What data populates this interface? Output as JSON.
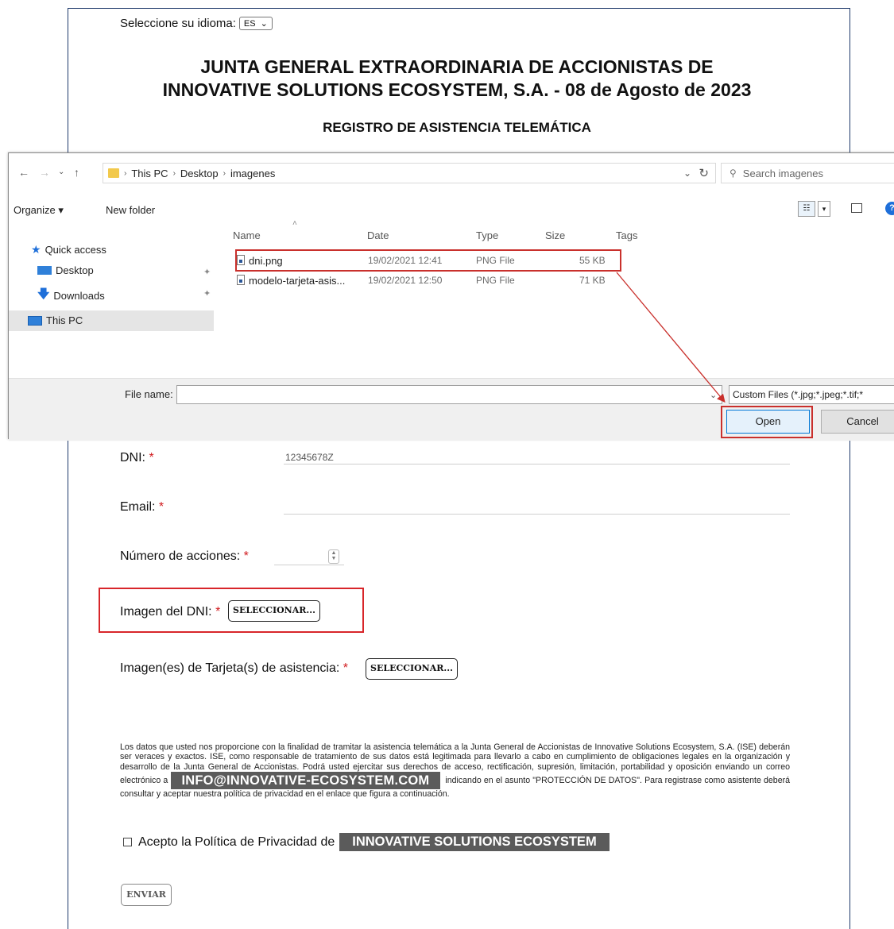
{
  "language": {
    "label": "Seleccione su idioma:",
    "selected": "ES"
  },
  "header": {
    "title_line1": "JUNTA GENERAL EXTRAORDINARIA DE ACCIONISTAS DE",
    "title_line2": "INNOVATIVE SOLUTIONS ECOSYSTEM, S.A. - 08 de Agosto de 2023",
    "subtitle": "REGISTRO DE ASISTENCIA TELEMÁTICA"
  },
  "dialog": {
    "breadcrumb": [
      "This PC",
      "Desktop",
      "imagenes"
    ],
    "search_placeholder": "Search imagenes",
    "toolbar": {
      "organize": "Organize ▾",
      "new_folder": "New folder"
    },
    "nav": {
      "quick_access": "Quick access",
      "desktop": "Desktop",
      "downloads": "Downloads",
      "this_pc": "This PC"
    },
    "columns": {
      "name": "Name",
      "date": "Date",
      "type": "Type",
      "size": "Size",
      "tags": "Tags"
    },
    "files": [
      {
        "name": "dni.png",
        "date": "19/02/2021 12:41",
        "type": "PNG File",
        "size": "55 KB"
      },
      {
        "name": "modelo-tarjeta-asis...",
        "date": "19/02/2021 12:50",
        "type": "PNG File",
        "size": "71 KB"
      }
    ],
    "file_name_label": "File name:",
    "file_name_value": "",
    "filter": "Custom Files (*.jpg;*.jpeg;*.tif;*",
    "open": "Open",
    "cancel": "Cancel"
  },
  "form": {
    "dni_label": "DNI:",
    "dni_value": "12345678Z",
    "email_label": "Email:",
    "acciones_label": "Número de acciones:",
    "imagen_dni_label": "Imagen del DNI:",
    "tarjeta_label": "Imagen(es) de Tarjeta(s) de asistencia:",
    "select_button": "SELECCIONAR...",
    "required_mark": "*",
    "legal_text_1": "Los datos que usted nos proporcione con la finalidad de tramitar la asistencia telemática a la Junta General de Accionistas de Innovative Solutions Ecosystem, S.A. (ISE) deberán ser veraces y exactos. ISE, como responsable de tratamiento de sus datos está legitimada para llevarlo a cabo en cumplimiento de obligaciones legales en la organización y desarrollo de la Junta General de Accionistas. Podrá usted ejercitar sus derechos de acceso, rectificación, supresión, limitación, portabilidad y oposición enviando un correo electrónico a",
    "legal_email": "INFO@INNOVATIVE-ECOSYSTEM.COM",
    "legal_text_2": "indicando en el asunto \"PROTECCIÓN DE DATOS\". Para registrase como asistente deberá consultar y aceptar nuestra política de privacidad en el enlace que figura a continuación.",
    "privacy_label": "Acepto la Política de Privacidad de",
    "privacy_company": "INNOVATIVE SOLUTIONS ECOSYSTEM",
    "submit": "ENVIAR"
  },
  "colors": {
    "highlight": "#d8262a",
    "chip": "#5b5b5b",
    "frame": "#1f3a6b"
  }
}
